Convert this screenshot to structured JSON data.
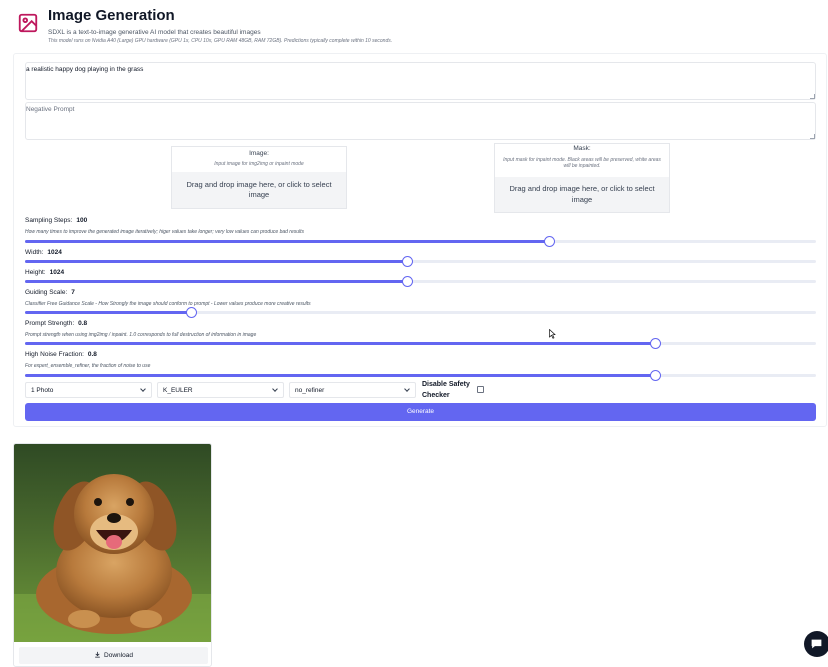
{
  "header": {
    "title": "Image Generation",
    "subtitle": "SDXL is a text-to-image generative AI model that creates beautiful images",
    "hardware_note": "This model runs on Nvidia A40 (Large) GPU hardware (GPU 1x, CPU 10x, GPU RAM 48GB, RAM 72GB). Predictions typically complete within 10 seconds."
  },
  "prompt": {
    "value": "a realistic happy dog playing in the grass",
    "negative_placeholder": "Negative Prompt"
  },
  "image_upload": {
    "label": "Image:",
    "hint": "Input image for img2img or inpaint mode",
    "dropzone": "Drag and drop image here, or click to select image"
  },
  "mask_upload": {
    "label": "Mask:",
    "hint": "Input mask for inpaint mode. Black areas will be preserved, white areas will be inpainted.",
    "dropzone": "Drag and drop image here, or click to select image"
  },
  "sliders": [
    {
      "label": "Sampling Steps:",
      "value": "100",
      "hint": "How many times to improve the generated image iteratively; higer values take longer; very low values can produce bad results",
      "fraction": 0.663
    },
    {
      "label": "Width:",
      "value": "1024",
      "hint": "",
      "fraction": 0.484
    },
    {
      "label": "Height:",
      "value": "1024",
      "hint": "",
      "fraction": 0.484
    },
    {
      "label": "Guiding Scale:",
      "value": "7",
      "hint": "Classifier Free Guidance Scale - How Strongly the image should conform to prompt - Lower values produce more creative results",
      "fraction": 0.21
    },
    {
      "label": "Prompt Strength:",
      "value": "0.8",
      "hint": "Prompt strength when using img2img / inpaint. 1.0 corresponds to full destruction of information in image",
      "fraction": 0.797
    },
    {
      "label": "High Noise Fraction:",
      "value": "0.8",
      "hint": "For expert_ensemble_refiner, the fraction of noise to use",
      "fraction": 0.797
    }
  ],
  "selects": {
    "num_outputs": "1 Photo",
    "scheduler": "K_EULER",
    "refiner": "no_refiner"
  },
  "safety_checker_label": "Disable Safety Checker",
  "generate_label": "Generate",
  "download_label": "Download",
  "colors": {
    "accent": "#6366f1",
    "logo": "#be185d"
  },
  "icons": [
    "image-icon",
    "chevron-down-icon",
    "download-icon",
    "chat-icon"
  ]
}
